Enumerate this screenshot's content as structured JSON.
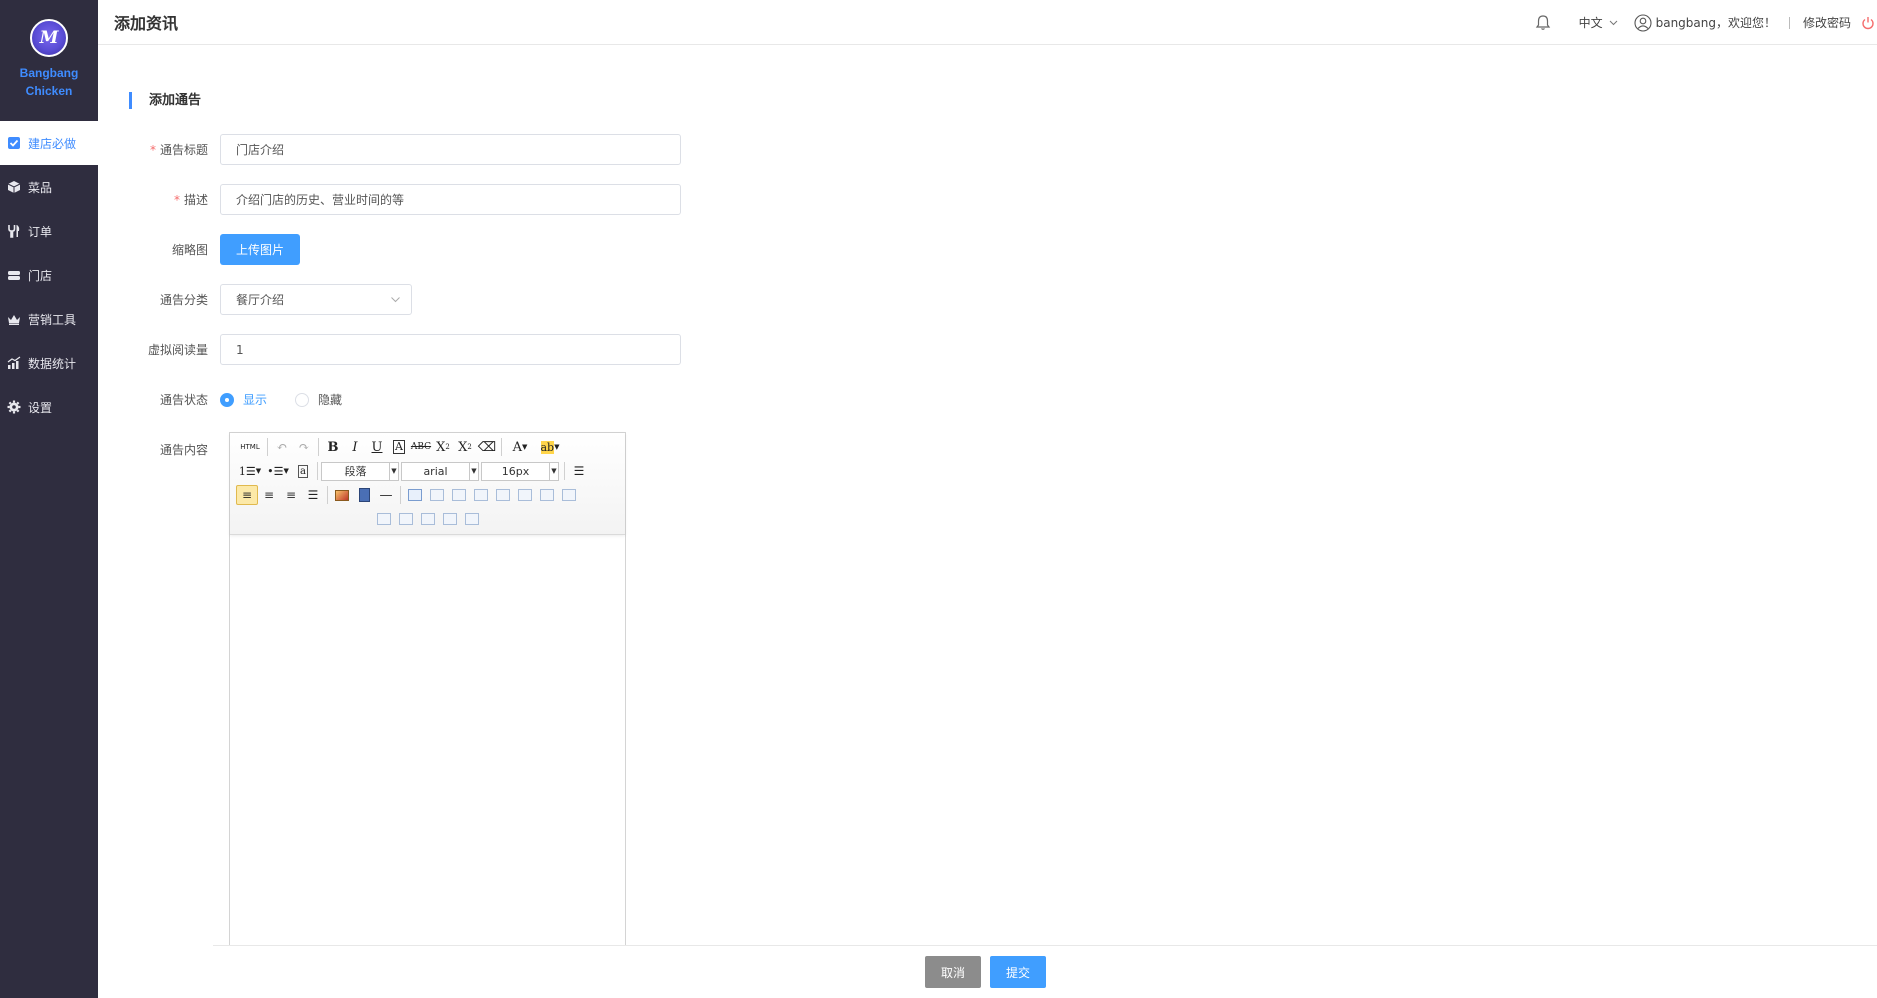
{
  "brand": {
    "logo_text": "M",
    "name": "Bangbang Chicken"
  },
  "sidebar": {
    "items": [
      {
        "label": "建店必做",
        "icon": "checkbox-icon",
        "active": true
      },
      {
        "label": "菜品",
        "icon": "box-icon",
        "active": false
      },
      {
        "label": "订单",
        "icon": "cutlery-icon",
        "active": false
      },
      {
        "label": "门店",
        "icon": "store-icon",
        "active": false
      },
      {
        "label": "营销工具",
        "icon": "crown-icon",
        "active": false
      },
      {
        "label": "数据统计",
        "icon": "chart-icon",
        "active": false
      },
      {
        "label": "设置",
        "icon": "gear-icon",
        "active": false
      }
    ]
  },
  "header": {
    "title": "添加资讯",
    "language": "中文",
    "user_greeting": "bangbang，欢迎您！",
    "change_password": "修改密码"
  },
  "form": {
    "section_title": "添加通告",
    "title_label": "通告标题",
    "title_value": "门店介绍",
    "desc_label": "描述",
    "desc_value": "介绍门店的历史、营业时间的等",
    "thumb_label": "缩略图",
    "upload_label": "上传图片",
    "category_label": "通告分类",
    "category_value": "餐厅介绍",
    "reads_label": "虚拟阅读量",
    "reads_value": "1",
    "status_label": "通告状态",
    "status_options": [
      "显示",
      "隐藏"
    ],
    "status_selected": "显示",
    "content_label": "通告内容"
  },
  "editor": {
    "html_label": "HTML",
    "paragraph": "段落",
    "font": "arial",
    "size": "16px"
  },
  "footer": {
    "cancel_label": "取消",
    "submit_label": "提交"
  },
  "colors": {
    "sidebar_bg": "#2f2d3f",
    "accent": "#409eff",
    "brand_blue": "#3f8cff",
    "required": "#f56c6c",
    "cancel_bg": "#8c8c8c"
  }
}
